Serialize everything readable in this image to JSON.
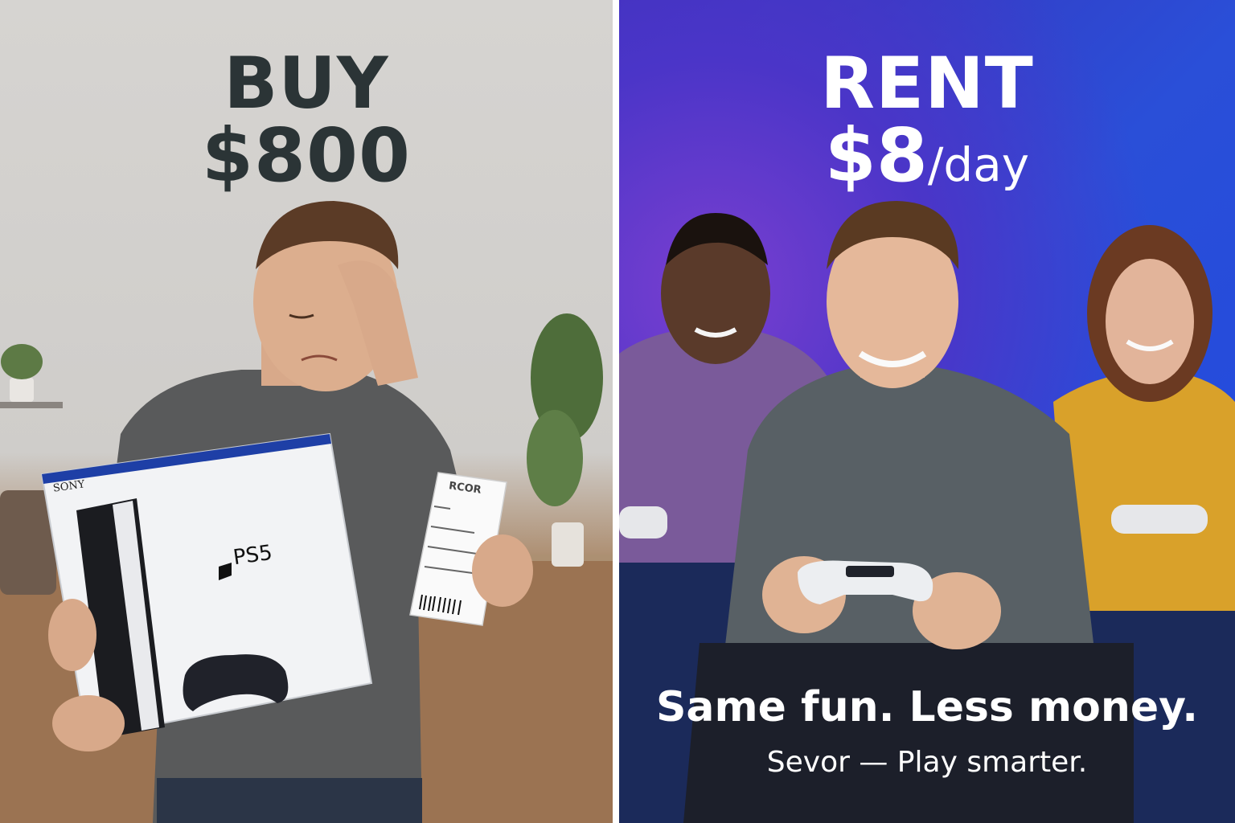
{
  "buy": {
    "title": "BUY",
    "price": "$800",
    "box_brand": "SONY",
    "box_product": "PS5",
    "receipt_header": "RCOR"
  },
  "rent": {
    "title": "RENT",
    "price": "$8",
    "unit": "/day",
    "tagline": "Same fun. Less money.",
    "brand_line": "Sevor — Play smarter."
  },
  "colors": {
    "buy_text": "#2b3436",
    "rent_text": "#ffffff",
    "rent_bg": "#2a4fd8",
    "buy_bg": "#d6d4d1"
  }
}
